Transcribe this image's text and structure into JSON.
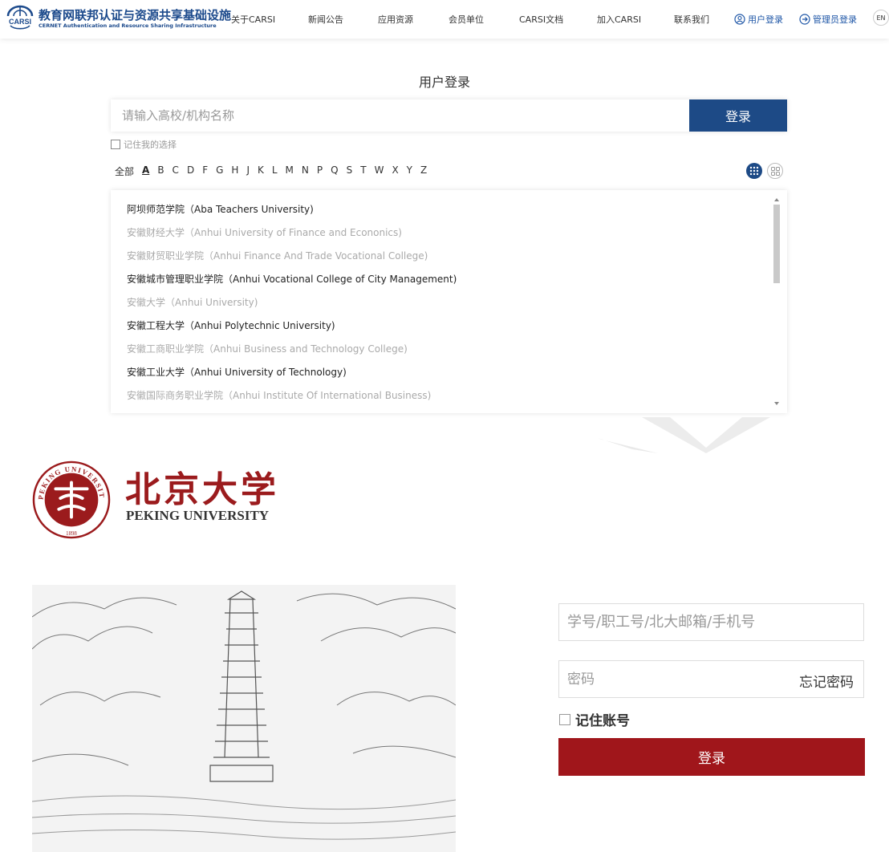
{
  "header": {
    "brand_cn": "教育网联邦认证与资源共享基础设施",
    "brand_en": "CERNET Authentication and Resource Sharing Infrastructure",
    "logo_text": "CARSI",
    "brand_color": "#1c4a8c",
    "nav": [
      {
        "label": "关于CARSI"
      },
      {
        "label": "新闻公告"
      },
      {
        "label": "应用资源"
      },
      {
        "label": "会员单位"
      },
      {
        "label": "CARSI文档"
      },
      {
        "label": "加入CARSI"
      },
      {
        "label": "联系我们"
      }
    ],
    "user_login": {
      "label": "用户登录",
      "icon": "user-circle-icon"
    },
    "admin_login": {
      "label": "管理员登录",
      "icon": "login-arrow-icon"
    },
    "language": "EN"
  },
  "login": {
    "title": "用户登录",
    "search_placeholder": "请输入高校/机构名称",
    "login_button": "登录",
    "button_color": "#1d4a86",
    "remember_label": "记住我的选择",
    "letters": [
      "全部",
      "A",
      "B",
      "C",
      "D",
      "F",
      "G",
      "H",
      "J",
      "K",
      "L",
      "M",
      "N",
      "P",
      "Q",
      "S",
      "T",
      "W",
      "X",
      "Y",
      "Z"
    ],
    "active_letter": "A",
    "view_icons": [
      "grid-view-icon",
      "tile-view-icon"
    ],
    "institutions": [
      {
        "name": "阿坝师范学院（Aba Teachers University)",
        "enabled": true
      },
      {
        "name": "安徽财经大学（Anhui University of Finance and Econonics)",
        "enabled": false
      },
      {
        "name": "安徽财贸职业学院（Anhui Finance And Trade Vocational College)",
        "enabled": false
      },
      {
        "name": "安徽城市管理职业学院（Anhui Vocational College of City Management)",
        "enabled": true
      },
      {
        "name": "安徽大学（Anhui University)",
        "enabled": false
      },
      {
        "name": "安徽工程大学（Anhui Polytechnic University)",
        "enabled": true
      },
      {
        "name": "安徽工商职业学院（Anhui Business and Technology College)",
        "enabled": false
      },
      {
        "name": "安徽工业大学（Anhui University of Technology)",
        "enabled": true
      },
      {
        "name": "安徽国际商务职业学院（Anhui Institute Of International Business)",
        "enabled": false
      }
    ]
  },
  "pku": {
    "name_cn": "北京大学",
    "name_en": "PEKING UNIVERSITY",
    "seal_text": "PEKING UNIVERSITY",
    "seal_year": "1898",
    "brand_color": "#9b1b1d",
    "username_placeholder": "学号/职工号/北大邮箱/手机号",
    "password_placeholder": "密码",
    "forgot_password": "忘记密码",
    "remember_account": "记住账号",
    "login_button": "登录",
    "button_color": "#a0161b"
  }
}
